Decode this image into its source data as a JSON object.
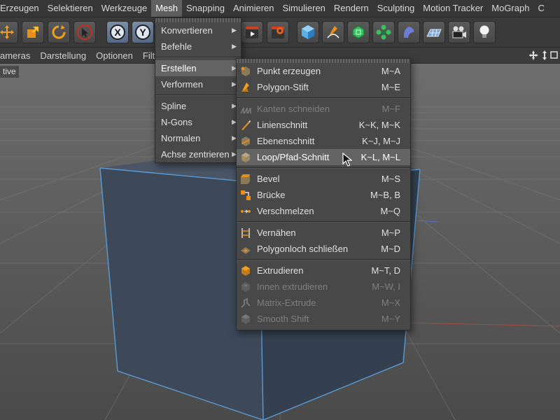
{
  "menubar": {
    "items": [
      "Erzeugen",
      "Selektieren",
      "Werkzeuge",
      "Mesh",
      "Snapping",
      "Animieren",
      "Simulieren",
      "Rendern",
      "Sculpting",
      "Motion Tracker",
      "MoGraph",
      "C"
    ]
  },
  "toolbar": {
    "buttons": [
      "move-tool",
      "scale-tool",
      "rotate-tool",
      "live-select-tool",
      "x-axis-lock",
      "y-axis-lock",
      "render-view",
      "render-settings",
      "cube-object",
      "pen-tool",
      "subdivision-object",
      "array-object",
      "deformer",
      "floor-object",
      "camera-object",
      "light-object"
    ]
  },
  "viewmenu": {
    "items": [
      "ameras",
      "Darstellung",
      "Optionen",
      "Filt"
    ]
  },
  "viewport": {
    "label": "tive"
  },
  "mesh_menu": {
    "items": [
      {
        "label": "Konvertieren",
        "submenu": true
      },
      {
        "label": "Befehle",
        "submenu": true
      },
      {
        "label": "Erstellen",
        "submenu": true,
        "active": true
      },
      {
        "label": "Verformen",
        "submenu": true
      },
      {
        "label": "Spline",
        "submenu": true
      },
      {
        "label": "N-Gons",
        "submenu": true
      },
      {
        "label": "Normalen",
        "submenu": true
      },
      {
        "label": "Achse zentrieren",
        "submenu": true
      }
    ]
  },
  "create_menu": {
    "items": [
      {
        "label": "Punkt erzeugen",
        "shortcut": "M~A",
        "icon": "point-create-icon",
        "enabled": true
      },
      {
        "label": "Polygon-Stift",
        "shortcut": "M~E",
        "icon": "polygon-pen-icon",
        "enabled": true
      },
      {
        "label": "Kanten schneiden",
        "shortcut": "M~F",
        "icon": "edge-cut-icon",
        "enabled": false
      },
      {
        "label": "Linienschnitt",
        "shortcut": "K~K, M~K",
        "icon": "knife-line-icon",
        "enabled": true
      },
      {
        "label": "Ebenenschnitt",
        "shortcut": "K~J, M~J",
        "icon": "plane-cut-icon",
        "enabled": true
      },
      {
        "label": "Loop/Pfad-Schnitt",
        "shortcut": "K~L, M~L",
        "icon": "loop-cut-icon",
        "enabled": true,
        "hover": true
      },
      {
        "label": "Bevel",
        "shortcut": "M~S",
        "icon": "bevel-icon",
        "enabled": true
      },
      {
        "label": "Brücke",
        "shortcut": "M~B, B",
        "icon": "bridge-icon",
        "enabled": true
      },
      {
        "label": "Verschmelzen",
        "shortcut": "M~Q",
        "icon": "weld-icon",
        "enabled": true
      },
      {
        "label": "Vernähen",
        "shortcut": "M~P",
        "icon": "stitch-icon",
        "enabled": true
      },
      {
        "label": "Polygonloch schließen",
        "shortcut": "M~D",
        "icon": "close-hole-icon",
        "enabled": true
      },
      {
        "label": "Extrudieren",
        "shortcut": "M~T, D",
        "icon": "extrude-icon",
        "enabled": true
      },
      {
        "label": "Innen extrudieren",
        "shortcut": "M~W, I",
        "icon": "extrude-inner-icon",
        "enabled": false
      },
      {
        "label": "Matrix-Extrude",
        "shortcut": "M~X",
        "icon": "matrix-extrude-icon",
        "enabled": false
      },
      {
        "label": "Smooth Shift",
        "shortcut": "M~Y",
        "icon": "smooth-shift-icon",
        "enabled": false
      }
    ]
  },
  "colors": {
    "menu_bg": "#484848",
    "highlight": "#646464",
    "accent_orange": "#e8901a",
    "cube_edge": "#5b9bd5"
  }
}
